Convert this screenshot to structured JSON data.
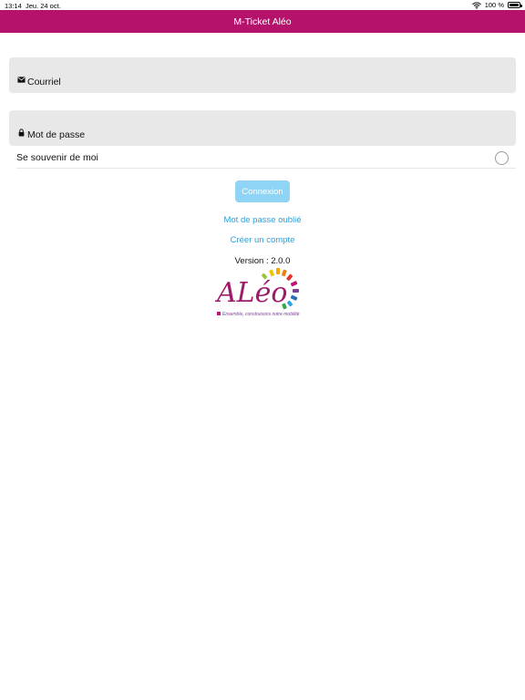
{
  "status_bar": {
    "time": "13:14",
    "date": "Jeu. 24 oct.",
    "battery_text": "100 %"
  },
  "nav": {
    "title": "M-Ticket Aléo"
  },
  "form": {
    "email_placeholder": "Courriel",
    "email_value": "",
    "password_placeholder": "Mot de passe",
    "password_value": "",
    "remember_label": "Se souvenir de moi",
    "remember_checked": false,
    "login_label": "Connexion"
  },
  "links": {
    "forgot_password": "Mot de passe oublié",
    "create_account": "Créer un compte"
  },
  "version": {
    "text": "Version : 2.0.0"
  },
  "logo": {
    "brand": "ALéo",
    "tagline": "Ensemble, construisons notre mobilité"
  },
  "colors": {
    "nav_background": "#b5126b",
    "link": "#2e9fd8",
    "button": "#8fd4f4",
    "field_background": "#e8e8e8"
  },
  "icons": {
    "email": "envelope-icon",
    "password": "lock-icon",
    "wifi": "wifi-icon",
    "battery": "battery-icon"
  }
}
